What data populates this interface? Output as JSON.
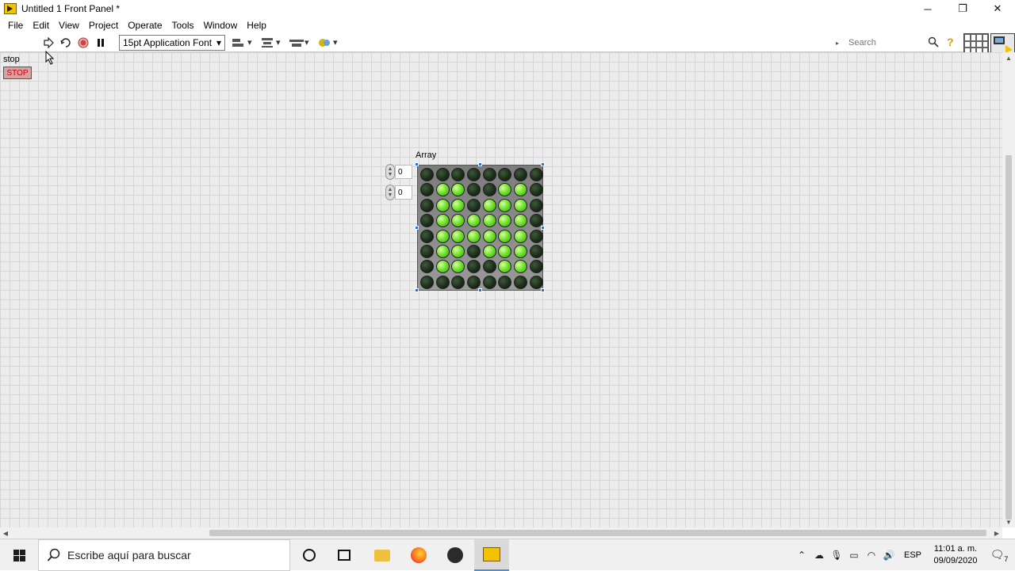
{
  "window": {
    "title": "Untitled 1 Front Panel *",
    "minimize": "─",
    "restore": "❐",
    "close": "✕"
  },
  "menu": [
    "File",
    "Edit",
    "View",
    "Project",
    "Operate",
    "Tools",
    "Window",
    "Help"
  ],
  "toolbar": {
    "run_icon": "run-arrow-icon",
    "run_continuous_icon": "run-continuously-icon",
    "abort_icon": "abort-icon",
    "pause_icon": "pause-icon",
    "font": "15pt Application Font",
    "search_placeholder": "Search",
    "help": "?"
  },
  "panel": {
    "stop_label": "stop",
    "stop_button": "STOP",
    "array_label": "Array",
    "index_row": "0",
    "index_col": "0",
    "led_on_color": "#6ddf2a",
    "led_off_color": "#1a2b18",
    "leds": [
      [
        0,
        0,
        0,
        0,
        0,
        0,
        0,
        0
      ],
      [
        0,
        1,
        1,
        0,
        0,
        1,
        1,
        0
      ],
      [
        0,
        1,
        1,
        0,
        1,
        1,
        1,
        0
      ],
      [
        0,
        1,
        1,
        1,
        1,
        1,
        1,
        0
      ],
      [
        0,
        1,
        1,
        1,
        1,
        1,
        1,
        0
      ],
      [
        0,
        1,
        1,
        0,
        1,
        1,
        1,
        0
      ],
      [
        0,
        1,
        1,
        0,
        0,
        1,
        1,
        0
      ],
      [
        0,
        0,
        0,
        0,
        0,
        0,
        0,
        0
      ]
    ]
  },
  "taskbar": {
    "search_text": "Escribe aquí para buscar",
    "language": "ESP",
    "time": "11:01 a. m.",
    "date": "09/09/2020",
    "notifications": "7"
  }
}
